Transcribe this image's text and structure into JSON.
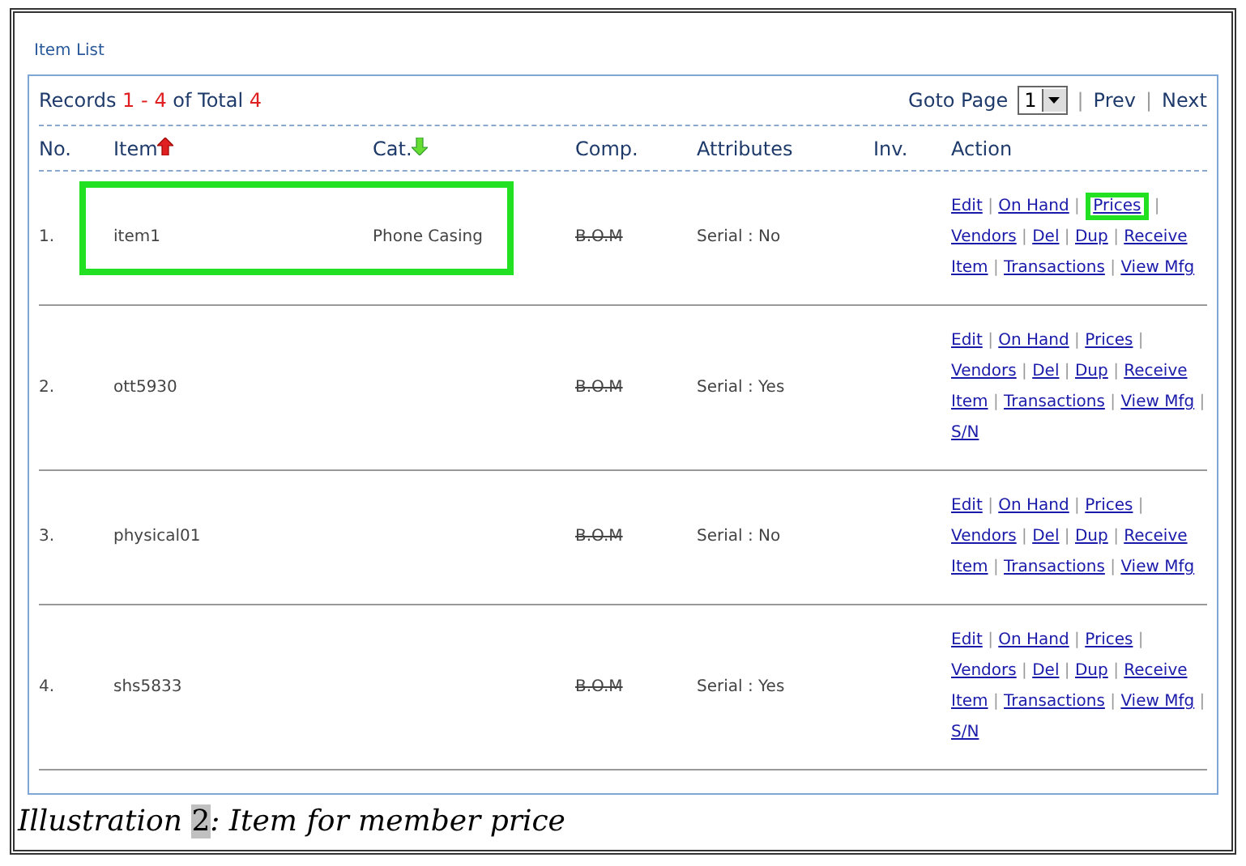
{
  "title": "Item List",
  "records": {
    "label": "Records",
    "from": "1",
    "dash": "-",
    "to": "4",
    "of": "of Total",
    "total": "4"
  },
  "pager": {
    "label": "Goto Page",
    "page": "1",
    "separator": "|",
    "links": [
      "Prev",
      "Next"
    ]
  },
  "columns": [
    {
      "label": "No."
    },
    {
      "label": "Item",
      "sort_ascending": true
    },
    {
      "label": "Cat.",
      "sort_ascending": false
    },
    {
      "label": "Comp."
    },
    {
      "label": "Attributes"
    },
    {
      "label": "Inv."
    },
    {
      "label": "Action"
    }
  ],
  "separator": "|",
  "rows": [
    {
      "no": "1.",
      "item": "item1",
      "cat": "Phone Casing",
      "comp": {
        "label": "B.O.M",
        "disabled": true
      },
      "attributes": "Serial : No",
      "highlighted": true,
      "actions": [
        {
          "label": "Edit",
          "separator": true
        },
        {
          "label": "On Hand",
          "separator": true
        },
        {
          "label": "Prices",
          "separator": true,
          "highlighted": true
        },
        {
          "label": "Vendors",
          "separator": true
        },
        {
          "label": "Del",
          "separator": true
        },
        {
          "label": "Dup",
          "separator": true
        },
        {
          "label": "Receive",
          "separator": false
        },
        {
          "label": "Item",
          "separator": true
        },
        {
          "label": "Transactions",
          "separator": true
        },
        {
          "label": "View Mfg",
          "separator": false
        }
      ]
    },
    {
      "no": "2.",
      "item": "ott5930",
      "comp": {
        "label": "B.O.M",
        "disabled": true
      },
      "attributes": "Serial : Yes",
      "highlighted": false,
      "actions": [
        {
          "label": "Edit",
          "separator": true
        },
        {
          "label": "On Hand",
          "separator": true
        },
        {
          "label": "Prices",
          "separator": true
        },
        {
          "label": "Vendors",
          "separator": true
        },
        {
          "label": "Del",
          "separator": true
        },
        {
          "label": "Dup",
          "separator": true
        },
        {
          "label": "Receive",
          "separator": false
        },
        {
          "label": "Item",
          "separator": true
        },
        {
          "label": "Transactions",
          "separator": true
        },
        {
          "label": "View Mfg",
          "separator": true
        },
        {
          "label": "S/N",
          "separator": false
        }
      ]
    },
    {
      "no": "3.",
      "item": "physical01",
      "comp": {
        "label": "B.O.M",
        "disabled": true
      },
      "attributes": "Serial : No",
      "highlighted": false,
      "actions": [
        {
          "label": "Edit",
          "separator": true
        },
        {
          "label": "On Hand",
          "separator": true
        },
        {
          "label": "Prices",
          "separator": true
        },
        {
          "label": "Vendors",
          "separator": true
        },
        {
          "label": "Del",
          "separator": true
        },
        {
          "label": "Dup",
          "separator": true
        },
        {
          "label": "Receive",
          "separator": false
        },
        {
          "label": "Item",
          "separator": true
        },
        {
          "label": "Transactions",
          "separator": true
        },
        {
          "label": "View Mfg",
          "separator": false
        }
      ]
    },
    {
      "no": "4.",
      "item": "shs5833",
      "comp": {
        "label": "B.O.M",
        "disabled": true
      },
      "attributes": "Serial : Yes",
      "highlighted": false,
      "actions": [
        {
          "label": "Edit",
          "separator": true
        },
        {
          "label": "On Hand",
          "separator": true
        },
        {
          "label": "Prices",
          "separator": true
        },
        {
          "label": "Vendors",
          "separator": true
        },
        {
          "label": "Del",
          "separator": true
        },
        {
          "label": "Dup",
          "separator": true
        },
        {
          "label": "Receive",
          "separator": false
        },
        {
          "label": "Item",
          "separator": true
        },
        {
          "label": "Transactions",
          "separator": true
        },
        {
          "label": "View Mfg",
          "separator": true
        },
        {
          "label": "S/N",
          "separator": false
        }
      ]
    }
  ],
  "caption": {
    "label": "Illustration",
    "number": "2",
    "text": ": Item for member price"
  }
}
